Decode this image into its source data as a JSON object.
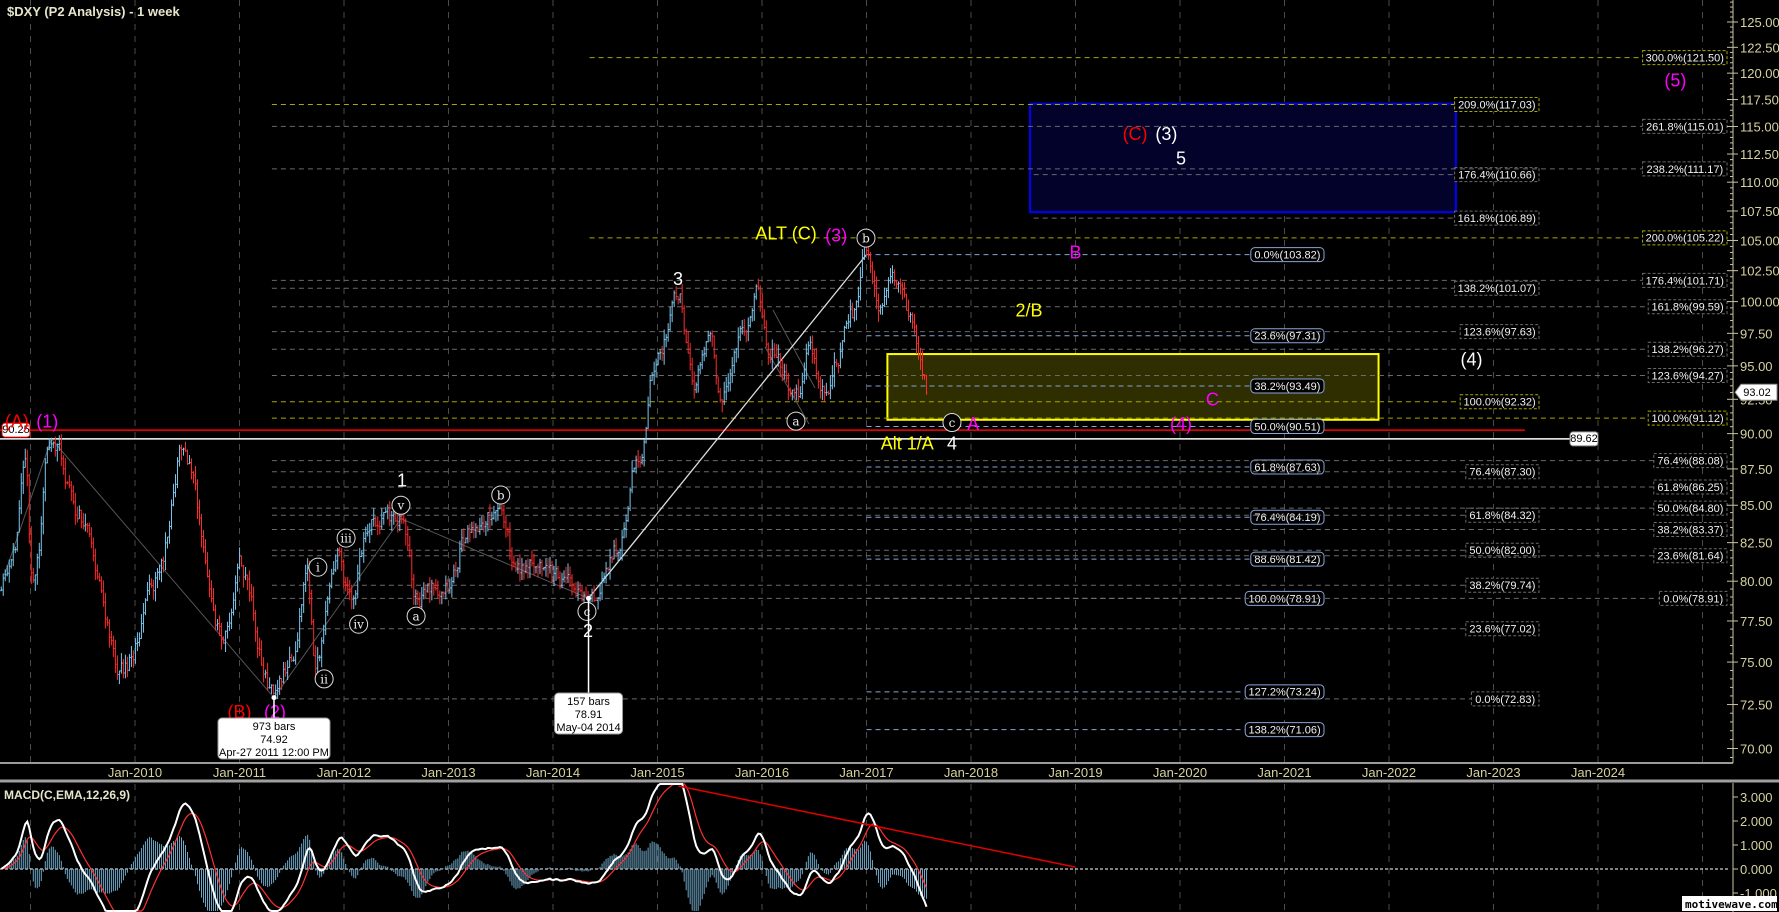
{
  "header": {
    "title": "$DXY (P2 Analysis) - 1 week"
  },
  "watermark": "motivewave.com",
  "colors": {
    "up_bar": "#7cc8f0",
    "down_bar": "#ff2a2a",
    "macd_line": "#ffffff",
    "signal_line": "#ff3030",
    "histogram": "#6fa8c8",
    "fib_primary": "#8aa4d8",
    "fib_secondary": "#6a6a6a",
    "fib_yellow": "#a8a800",
    "zone_yellow": "#ffff00",
    "zone_blue": "#0000ff"
  },
  "chart_data": {
    "type": "ohlc",
    "title": "$DXY (P2 Analysis) - 1 week",
    "xlabel": "",
    "ylabel": "",
    "ylim": [
      69.2,
      127.2
    ],
    "yscale": "log",
    "xlim": [
      2008.72,
      2025.2
    ],
    "y_ticks": [
      "125.00",
      "122.50",
      "120.00",
      "117.50",
      "115.00",
      "112.50",
      "110.00",
      "107.50",
      "105.00",
      "102.50",
      "100.00",
      "97.50",
      "95.00",
      "92.50",
      "90.00",
      "87.50",
      "85.00",
      "82.50",
      "80.00",
      "77.50",
      "75.00",
      "72.50",
      "70.00"
    ],
    "x_ticks": [
      "Jan-2010",
      "Jan-2011",
      "Jan-2012",
      "Jan-2013",
      "Jan-2014",
      "Jan-2015",
      "Jan-2016",
      "Jan-2017",
      "Jan-2018",
      "Jan-2019",
      "Jan-2020",
      "Jan-2021",
      "Jan-2022",
      "Jan-2023",
      "Jan-2024"
    ],
    "grid": true,
    "last_price": "93.02",
    "price": {
      "interval": "1 week",
      "swing_points": [
        [
          2008.72,
          80.0
        ],
        [
          2008.85,
          82.0
        ],
        [
          2008.95,
          88.7
        ],
        [
          2009.02,
          79.5
        ],
        [
          2009.2,
          89.62
        ],
        [
          2009.45,
          84.5
        ],
        [
          2009.9,
          74.5
        ],
        [
          2010.2,
          79.9
        ],
        [
          2010.45,
          88.7
        ],
        [
          2010.85,
          76.6
        ],
        [
          2011.0,
          81.2
        ],
        [
          2011.33,
          72.9
        ],
        [
          2011.5,
          75.0
        ],
        [
          2011.65,
          80.0
        ],
        [
          2011.72,
          75.0
        ],
        [
          2011.95,
          81.8
        ],
        [
          2012.05,
          78.8
        ],
        [
          2012.25,
          83.8
        ],
        [
          2012.545,
          84.1
        ],
        [
          2012.7,
          78.9
        ],
        [
          2013.0,
          79.8
        ],
        [
          2013.2,
          83.4
        ],
        [
          2013.5,
          84.8
        ],
        [
          2013.65,
          81.0
        ],
        [
          2013.85,
          81.0
        ],
        [
          2014.0,
          80.0
        ],
        [
          2014.34,
          78.91
        ],
        [
          2014.6,
          82.0
        ],
        [
          2014.8,
          87.5
        ],
        [
          2015.0,
          95.8
        ],
        [
          2015.2,
          100.4
        ],
        [
          2015.35,
          93.4
        ],
        [
          2015.5,
          97.5
        ],
        [
          2015.6,
          93.0
        ],
        [
          2015.8,
          97.0
        ],
        [
          2015.95,
          100.5
        ],
        [
          2016.1,
          96.0
        ],
        [
          2016.35,
          92.6
        ],
        [
          2016.45,
          96.5
        ],
        [
          2016.6,
          93.5
        ],
        [
          2016.75,
          96.0
        ],
        [
          2016.85,
          99.0
        ],
        [
          2017.0,
          103.82
        ],
        [
          2017.15,
          99.5
        ],
        [
          2017.25,
          102.0
        ],
        [
          2017.4,
          99.5
        ],
        [
          2017.5,
          96.5
        ],
        [
          2017.59,
          93.02
        ]
      ]
    },
    "horizontal_lines": [
      {
        "label": "90.25",
        "price": 90.25,
        "color": "#ff0000",
        "to_t": 2023.3
      },
      {
        "label": "89.62",
        "price": 89.62,
        "color": "#ffffff",
        "to_t": 2024.0
      }
    ],
    "zones": [
      {
        "name": "yellow-target-zone",
        "from_t": 2017.2,
        "to_t": 2021.9,
        "top": 95.9,
        "bottom": 91.0,
        "stroke": "#ffff00",
        "fill": "#2e2e00"
      },
      {
        "name": "blue-target-zone",
        "from_t": 2018.565,
        "to_t": 2022.64,
        "top": 117.1,
        "bottom": 107.4,
        "stroke": "#0000ff",
        "fill": "#02022a"
      }
    ],
    "fib_sets": [
      {
        "style": "primary",
        "from_t": 2017.0,
        "items": [
          {
            "label": "0.0%(103.82)",
            "price": 103.82
          },
          {
            "label": "23.6%(97.31)",
            "price": 97.31
          },
          {
            "label": "38.2%(93.49)",
            "price": 93.49
          },
          {
            "label": "50.0%(90.51)",
            "price": 90.51
          },
          {
            "label": "61.8%(87.63)",
            "price": 87.63
          },
          {
            "label": "76.4%(84.19)",
            "price": 84.19
          },
          {
            "label": "88.6%(81.42)",
            "price": 81.42
          },
          {
            "label": "100.0%(78.91)",
            "price": 78.91
          },
          {
            "label": "127.2%(73.24)",
            "price": 73.24
          },
          {
            "label": "138.2%(71.06)",
            "price": 71.06
          }
        ]
      },
      {
        "style": "secondary",
        "items": [
          {
            "label": "209.0%(117.03)",
            "price": 117.03,
            "yellow": true,
            "from_t": 2011.31
          },
          {
            "label": "176.4%(110.66)",
            "price": 110.66,
            "from_t": 2018.6
          },
          {
            "label": "161.8%(106.89)",
            "price": 106.89,
            "from_t": 2018.6
          },
          {
            "label": "138.2%(101.07)",
            "price": 101.07,
            "from_t": 2011.31
          },
          {
            "label": "123.6%(97.63)",
            "price": 97.63,
            "from_t": 2011.31
          },
          {
            "label": "100.0%(92.32)",
            "price": 92.32,
            "yellow": true,
            "from_t": 2011.31
          },
          {
            "label": "76.4%(87.30)",
            "price": 87.3,
            "from_t": 2011.31
          },
          {
            "label": "61.8%(84.32)",
            "price": 84.32,
            "from_t": 2011.31
          },
          {
            "label": "50.0%(82.00)",
            "price": 82.0,
            "from_t": 2011.31
          },
          {
            "label": "38.2%(79.74)",
            "price": 79.74,
            "from_t": 2011.31
          },
          {
            "label": "23.6%(77.02)",
            "price": 77.02,
            "from_t": 2011.31
          },
          {
            "label": "0.0%(72.83)",
            "price": 72.83,
            "from_t": 2011.31
          }
        ]
      },
      {
        "style": "tertiary",
        "items": [
          {
            "label": "300.0%(121.50)",
            "price": 121.5,
            "yellow": true,
            "from_t": 2014.35
          },
          {
            "label": "261.8%(115.01)",
            "price": 115.01,
            "from_t": 2011.31
          },
          {
            "label": "238.2%(111.17)",
            "price": 111.17,
            "from_t": 2011.31
          },
          {
            "label": "200.0%(105.22)",
            "price": 105.22,
            "yellow": true,
            "from_t": 2014.35
          },
          {
            "label": "176.4%(101.71)",
            "price": 101.71,
            "from_t": 2011.31
          },
          {
            "label": "161.8%(99.59)",
            "price": 99.59,
            "from_t": 2011.31
          },
          {
            "label": "138.2%(96.27)",
            "price": 96.27,
            "from_t": 2011.31
          },
          {
            "label": "123.6%(94.27)",
            "price": 94.27,
            "from_t": 2011.31
          },
          {
            "label": "100.0%(91.12)",
            "price": 91.12,
            "yellow": true,
            "from_t": 2011.31
          },
          {
            "label": "76.4%(88.08)",
            "price": 88.08,
            "from_t": 2011.31
          },
          {
            "label": "61.8%(86.25)",
            "price": 86.25,
            "from_t": 2011.31
          },
          {
            "label": "50.0%(84.80)",
            "price": 84.8,
            "from_t": 2011.31
          },
          {
            "label": "38.2%(83.37)",
            "price": 83.37,
            "from_t": 2011.31
          },
          {
            "label": "23.6%(81.64)",
            "price": 81.64,
            "from_t": 2011.31
          },
          {
            "label": "0.0%(78.91)",
            "price": 78.91,
            "from_t": 2011.31
          }
        ]
      }
    ],
    "wave_labels": [
      {
        "text": "(A)",
        "color": "#ff0000",
        "t": 2008.87,
        "price": 90.8
      },
      {
        "text": "(1)",
        "color": "#ff00ff",
        "t": 2009.16,
        "price": 90.8
      },
      {
        "text": "(B)",
        "color": "#ff0000",
        "t": 2011.0,
        "price": 72.0
      },
      {
        "text": "(2)",
        "color": "#ff00ff",
        "t": 2011.34,
        "price": 72.0
      },
      {
        "text": "1",
        "color": "#ffffff",
        "t": 2012.555,
        "price": 86.6
      },
      {
        "text": "2",
        "color": "#ffffff",
        "t": 2014.335,
        "price": 76.8
      },
      {
        "text": "3",
        "color": "#ffffff",
        "t": 2015.196,
        "price": 101.7
      },
      {
        "text": "ALT (C)",
        "color": "#ffff00",
        "t": 2016.23,
        "price": 105.5
      },
      {
        "text": "(3)",
        "color": "#ff00ff",
        "t": 2016.71,
        "price": 105.3
      },
      {
        "text": "B",
        "color": "#ff00ff",
        "t": 2019.0,
        "price": 103.9
      },
      {
        "text": "2/B",
        "color": "#ffff00",
        "t": 2018.555,
        "price": 99.2
      },
      {
        "text": "Alt 1/A",
        "color": "#ffff00",
        "t": 2017.39,
        "price": 89.2
      },
      {
        "text": "4",
        "color": "#ffffff",
        "t": 2017.818,
        "price": 89.2
      },
      {
        "text": "A",
        "color": "#ff00ff",
        "t": 2018.02,
        "price": 90.6
      },
      {
        "text": "C",
        "color": "#ff00ff",
        "t": 2020.31,
        "price": 92.4
      },
      {
        "text": "(4)",
        "color": "#ff00ff",
        "t": 2020.01,
        "price": 90.6
      },
      {
        "text": "(C)",
        "color": "#ff0000",
        "t": 2019.57,
        "price": 114.2
      },
      {
        "text": "(3)",
        "color": "#ffffff",
        "t": 2019.87,
        "price": 114.2
      },
      {
        "text": "5",
        "color": "#ffffff",
        "t": 2020.01,
        "price": 112.0
      },
      {
        "text": "(4)",
        "color": "#ffffff",
        "t": 2022.79,
        "price": 95.4
      },
      {
        "text": "(5)",
        "color": "#ff00ff",
        "t": 2024.74,
        "price": 119.2
      }
    ],
    "circled_labels": [
      {
        "text": "i",
        "t": 2011.75,
        "price": 80.9
      },
      {
        "text": "ii",
        "t": 2011.81,
        "price": 74.0
      },
      {
        "text": "iii",
        "t": 2012.02,
        "price": 82.8
      },
      {
        "text": "iv",
        "t": 2012.14,
        "price": 77.3
      },
      {
        "text": "v",
        "t": 2012.545,
        "price": 85.0
      },
      {
        "text": "a",
        "t": 2012.69,
        "price": 77.8
      },
      {
        "text": "b",
        "t": 2013.5,
        "price": 85.7
      },
      {
        "text": "c",
        "t": 2014.325,
        "price": 78.1
      },
      {
        "text": "a",
        "t": 2016.325,
        "price": 90.9
      },
      {
        "text": "b",
        "t": 2016.995,
        "price": 105.2
      },
      {
        "text": "c",
        "t": 2017.818,
        "price": 90.8
      }
    ],
    "info_boxes": [
      {
        "lines": [
          "973 bars",
          "74.92",
          "Apr-27 2011 12:00 PM"
        ],
        "t": 2011.33,
        "price": 72.9
      },
      {
        "lines": [
          "157 bars",
          "78.91",
          "May-04 2014"
        ],
        "t": 2014.34,
        "price": 78.91
      }
    ],
    "wave_paths": [
      [
        [
          2008.75,
          80.4
        ],
        [
          2009.2,
          89.62
        ],
        [
          2011.33,
          72.9
        ],
        [
          2012.545,
          84.1
        ],
        [
          2014.34,
          78.91
        ]
      ]
    ],
    "trend_line": [
      [
        2014.34,
        78.91
      ],
      [
        2017.0,
        103.82
      ]
    ],
    "macd": {
      "title": "MACD(C,EMA,12,26,9)",
      "params": [
        12,
        26,
        9
      ],
      "y_ticks": [
        "3.000",
        "2.000",
        "1.000",
        "0.000",
        "-1.000"
      ],
      "trend_line": [
        [
          2015.2,
          3.46
        ],
        [
          2019.0,
          0.08
        ]
      ]
    }
  }
}
